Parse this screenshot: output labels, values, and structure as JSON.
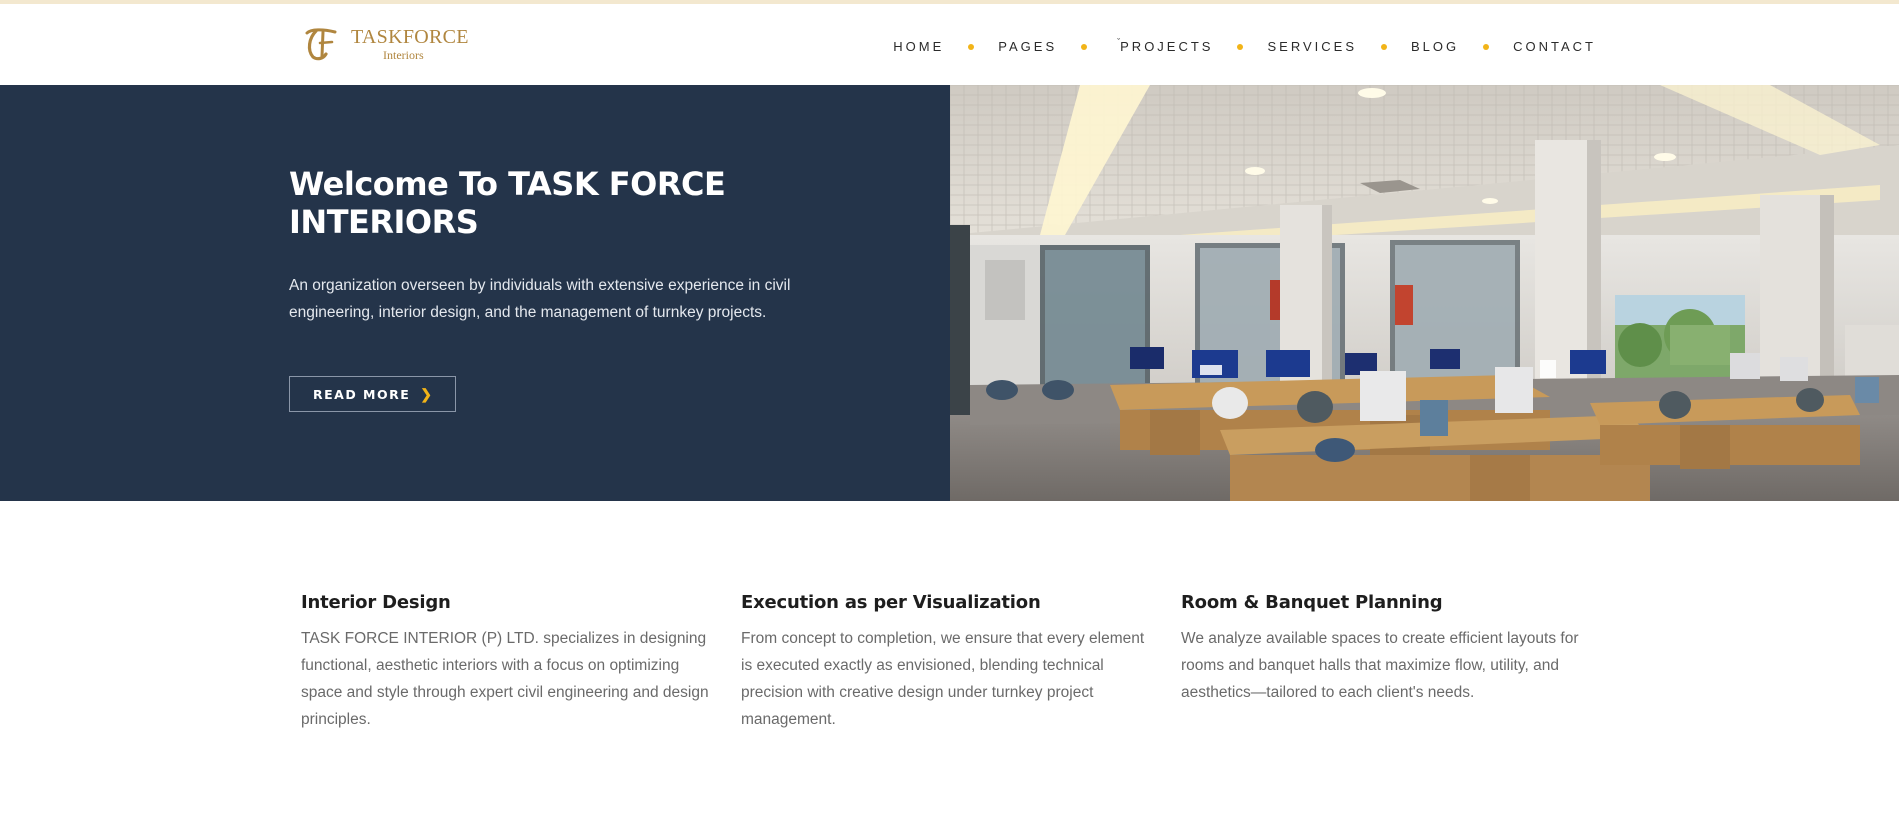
{
  "brand": {
    "name": "TASKFORCE",
    "sub": "Interiors",
    "color": "#b0863f"
  },
  "nav": {
    "items": [
      {
        "label": "HOME"
      },
      {
        "label": "PAGES"
      },
      {
        "label": "PROJECTS"
      },
      {
        "label": "SERVICES"
      },
      {
        "label": "BLOG"
      },
      {
        "label": "CONTACT"
      }
    ],
    "dot_color": "#f2b418"
  },
  "hero": {
    "title": "Welcome To TASK FORCE INTERIORS",
    "description": "An organization overseen by individuals with extensive experience in civil engineering, interior design, and the management of turnkey projects.",
    "button_label": "READ MORE",
    "button_icon": "chevron-right-icon",
    "background": "#24344a"
  },
  "features": [
    {
      "title": "Interior Design",
      "text": "TASK FORCE INTERIOR (P) LTD. specializes in designing functional, aesthetic interiors with a focus on optimizing space and style through expert civil engineering and design principles."
    },
    {
      "title": "Execution as per Visualization",
      "text": "From concept to completion, we ensure that every element is executed exactly as envisioned, blending technical precision with creative design under turnkey project management."
    },
    {
      "title": "Room & Banquet Planning",
      "text": "We analyze available spaces to create efficient layouts for rooms and banquet halls that maximize flow, utility, and aesthetics—tailored to each client's needs."
    }
  ]
}
